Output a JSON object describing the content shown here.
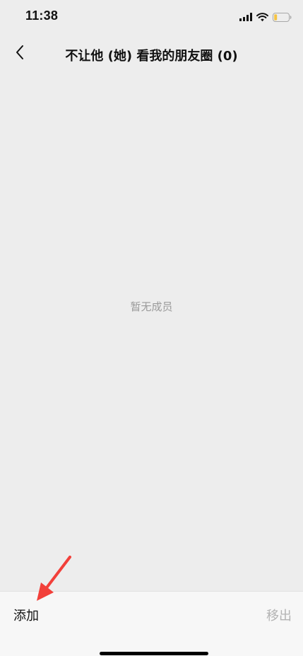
{
  "status_bar": {
    "time": "11:38",
    "icons": [
      "signal-icon",
      "wifi-icon",
      "battery-icon"
    ],
    "battery_color": "#f5c342"
  },
  "nav": {
    "back_icon": "chevron-left-icon",
    "title": "不让他 (她) 看我的朋友圈 (0)"
  },
  "empty_state": {
    "text": "暂无成员"
  },
  "toolbar": {
    "add_label": "添加",
    "remove_label": "移出"
  },
  "annotation": {
    "arrow_color": "#f2403a"
  }
}
